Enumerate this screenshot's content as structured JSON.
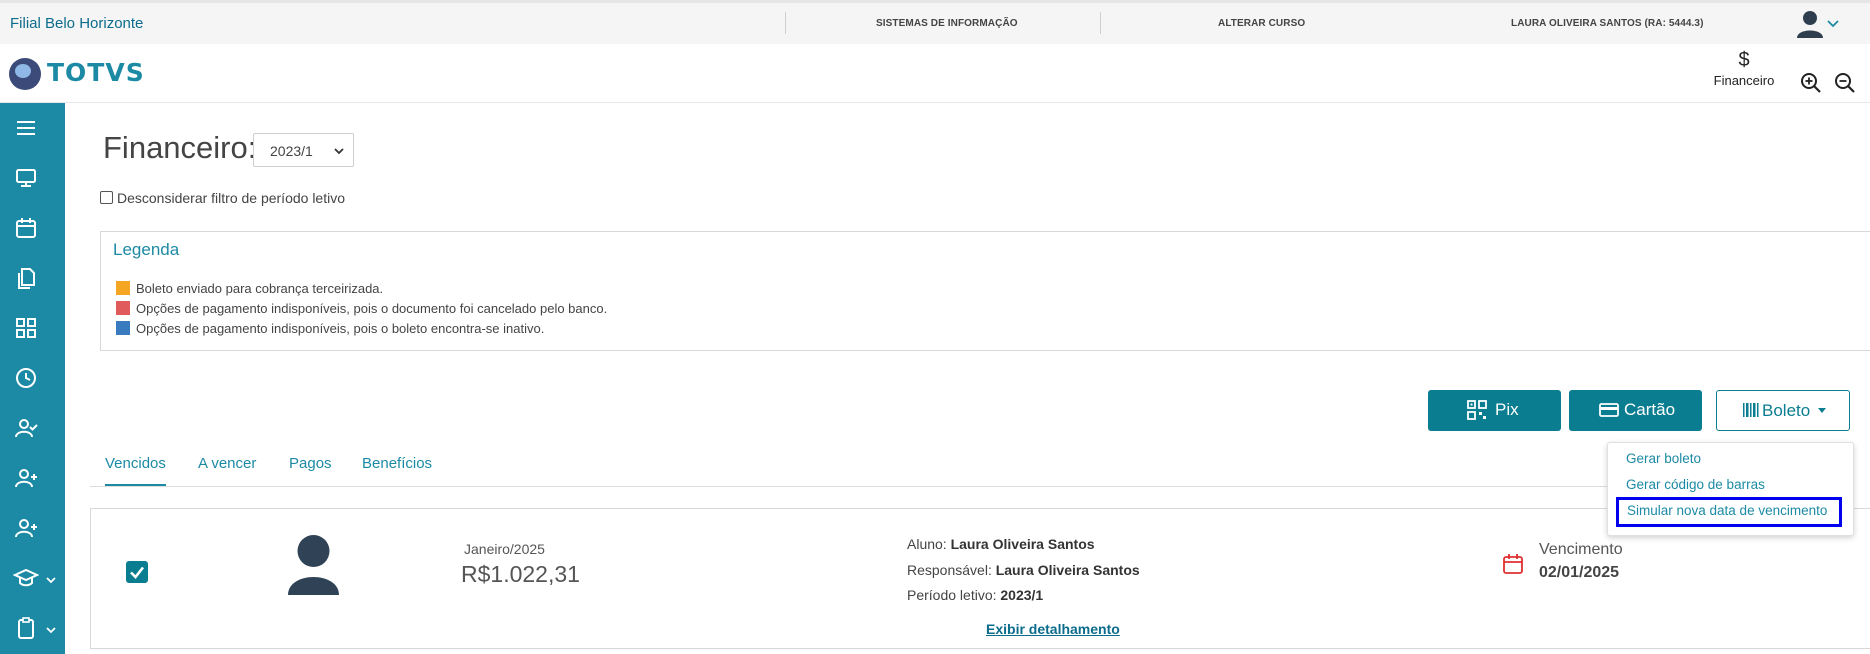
{
  "topbar": {
    "branch": "Filial Belo Horizonte",
    "links": [
      "SISTEMAS DE INFORMAÇÃO",
      "ALTERAR CURSO",
      "LAURA OLIVEIRA SANTOS (RA: 5444.3)"
    ]
  },
  "brand": {
    "logo_text": "TOTVS"
  },
  "shortcut": {
    "symbol": "$",
    "label": "Financeiro"
  },
  "sidebar": {
    "icons": [
      "menu-icon",
      "monitor-icon",
      "calendar-icon",
      "documents-icon",
      "grid-icon",
      "clock-icon",
      "user-check-icon",
      "user-plus-icon",
      "user-add-icon",
      "graduation-cap-icon",
      "clipboard-icon"
    ]
  },
  "page": {
    "title": "Financeiro:",
    "period_selected": "2023/1",
    "ignore_filter_label": "Desconsiderar filtro de período letivo"
  },
  "legend": {
    "title": "Legenda",
    "items": [
      {
        "label": "Boleto enviado para cobrança terceirizada.",
        "color": "#f5a623"
      },
      {
        "label": "Opções de pagamento indisponíveis, pois o documento foi cancelado pelo banco.",
        "color": "#e05c5c"
      },
      {
        "label": "Opções de pagamento indisponíveis, pois o boleto encontra-se inativo.",
        "color": "#3a7abf"
      }
    ]
  },
  "actions": {
    "pix": "Pix",
    "card": "Cartão",
    "boleto": "Boleto"
  },
  "boleto_menu": [
    "Gerar boleto",
    "Gerar código de barras",
    "Simular nova data de vencimento"
  ],
  "tabs": [
    "Vencidos",
    "A vencer",
    "Pagos",
    "Benefícios"
  ],
  "invoice": {
    "month": "Janeiro/2025",
    "amount": "R$1.022,31",
    "student_label": "Aluno:",
    "student": "Laura Oliveira Santos",
    "responsible_label": "Responsável:",
    "responsible": "Laura Oliveira Santos",
    "period_label": "Período letivo:",
    "period": "2023/1",
    "detail_link": "Exibir detalhamento",
    "due_label": "Vencimento",
    "due_date": "02/01/2025"
  },
  "colors": {
    "primary": "#1c8aa4",
    "button": "#0b7d90",
    "highlight": "#0000ee"
  }
}
